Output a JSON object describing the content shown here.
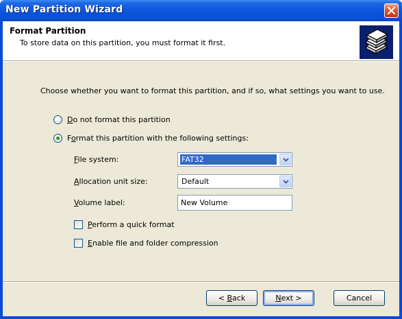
{
  "window": {
    "title": "New Partition Wizard"
  },
  "header": {
    "title": "Format Partition",
    "subtitle": "To store data on this partition, you must format it first.",
    "icon": "disk-stack-icon"
  },
  "prompt": "Choose whether you want to format this partition, and if so, what settings you want to use.",
  "options": {
    "no_format": {
      "mnemonic": "D",
      "rest": "o not format this partition",
      "selected": false
    },
    "format": {
      "pre": "F",
      "mnemonic": "o",
      "rest": "rmat this partition with the following settings:",
      "selected": true
    }
  },
  "settings": {
    "file_system": {
      "mnemonic": "F",
      "rest": "ile system:",
      "value": "FAT32"
    },
    "allocation": {
      "mnemonic": "A",
      "rest": "llocation unit size:",
      "value": "Default"
    },
    "volume_label": {
      "mnemonic": "V",
      "rest": "olume label:",
      "value": "New Volume"
    },
    "quick_format": {
      "mnemonic": "P",
      "rest": "erform a quick format",
      "checked": false
    },
    "compression": {
      "mnemonic": "E",
      "rest": "nable file and folder compression",
      "checked": false
    }
  },
  "buttons": {
    "back": {
      "pre": "< ",
      "mnemonic": "B",
      "rest": "ack"
    },
    "next": {
      "mnemonic": "N",
      "rest": "ext >"
    },
    "cancel": "Cancel"
  },
  "colors": {
    "titlebar": "#0a4ad8",
    "dialog_bg": "#ece9d8",
    "selection": "#316ac5",
    "radio_dot": "#21a121"
  }
}
